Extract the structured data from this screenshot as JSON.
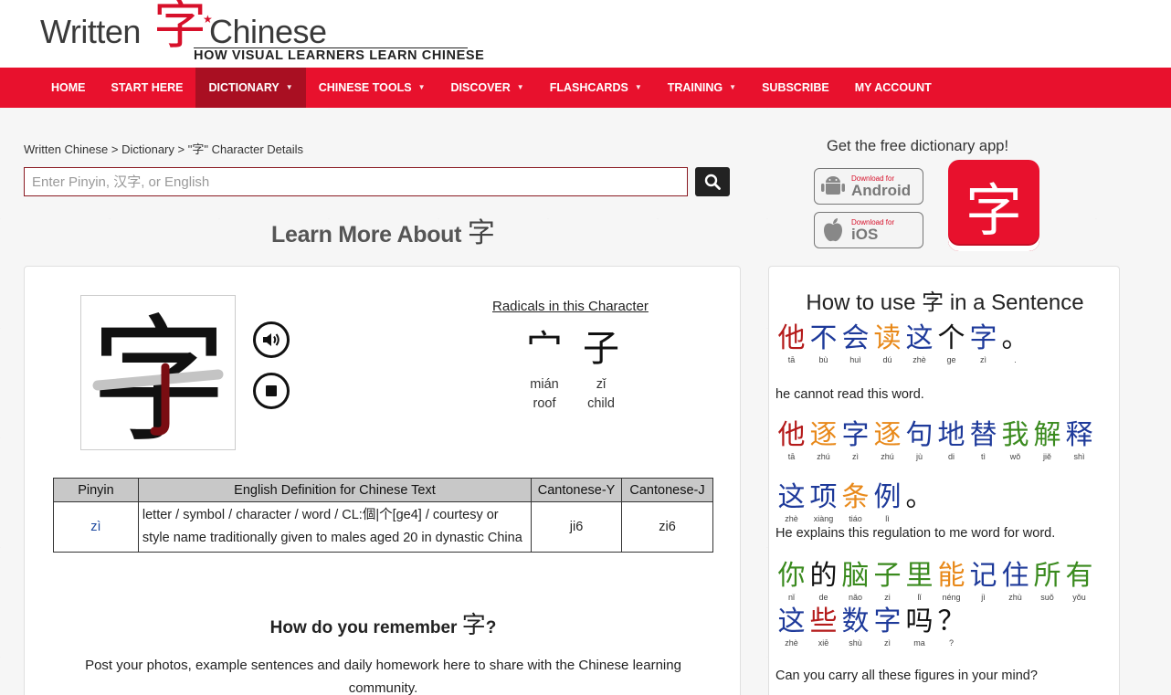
{
  "logo": {
    "word1": "Written",
    "char": "字",
    "word2": "Chinese",
    "tagline": "HOW VISUAL LEARNERS LEARN CHINESE"
  },
  "nav": [
    {
      "label": "HOME",
      "caret": false,
      "active": false
    },
    {
      "label": "START HERE",
      "caret": false,
      "active": false
    },
    {
      "label": "DICTIONARY",
      "caret": true,
      "active": true
    },
    {
      "label": "CHINESE TOOLS",
      "caret": true,
      "active": false
    },
    {
      "label": "DISCOVER",
      "caret": true,
      "active": false
    },
    {
      "label": "FLASHCARDS",
      "caret": true,
      "active": false
    },
    {
      "label": "TRAINING",
      "caret": true,
      "active": false
    },
    {
      "label": "SUBSCRIBE",
      "caret": false,
      "active": false
    },
    {
      "label": "MY ACCOUNT",
      "caret": false,
      "active": false
    }
  ],
  "breadcrumb": {
    "home": "Written Chinese",
    "sep": ">",
    "dictionary": "Dictionary",
    "current": "\"字\" Character Details"
  },
  "search": {
    "placeholder": "Enter Pinyin, 汉字, or English",
    "value": ""
  },
  "learn_more": {
    "text": "Learn More About",
    "char": "字"
  },
  "app": {
    "title": "Get the free dictionary app!",
    "android_small": "Download for",
    "android_big": "Android",
    "ios_small": "Download for",
    "ios_big": "iOS",
    "icon_char": "字"
  },
  "character": {
    "glyph": "字",
    "radicals_title": "Radicals in this Character",
    "radicals": [
      {
        "char": "宀",
        "pinyin": "mián",
        "meaning": "roof"
      },
      {
        "char": "子",
        "pinyin": "zǐ",
        "meaning": "child"
      }
    ]
  },
  "table": {
    "headers": [
      "Pinyin",
      "English Definition for Chinese Text",
      "Cantonese-Y",
      "Cantonese-J"
    ],
    "row": {
      "pinyin": "zì",
      "definition": "letter / symbol / character / word / CL:個|个[ge4] / courtesy or style name traditionally given to males aged 20 in dynastic China",
      "cantonese_y": "ji6",
      "cantonese_j": "zi6"
    }
  },
  "remember": {
    "text": "How do you remember",
    "char": "字",
    "q": "?",
    "post": "Post your photos, example sentences and daily homework here to share with the Chinese learning community."
  },
  "sentences_panel": {
    "title_before": "How to use",
    "char": "字",
    "title_after": "in a Sentence"
  },
  "colors": {
    "brand_red": "#e8112d",
    "nav_active": "#a90f22",
    "tone1": "#b41a1a",
    "tone2": "#e8891a",
    "tone3": "#3a8a1e",
    "tone4": "#1e3a9a",
    "neutral": "#111111"
  },
  "sentences": [
    {
      "chars": [
        {
          "c": "他",
          "p": "tā",
          "t": "tone1"
        },
        {
          "c": "不",
          "p": "bù",
          "t": "tone4"
        },
        {
          "c": "会",
          "p": "huì",
          "t": "tone4"
        },
        {
          "c": "读",
          "p": "dú",
          "t": "tone2"
        },
        {
          "c": "这",
          "p": "zhè",
          "t": "tone4"
        },
        {
          "c": "个",
          "p": "ge",
          "t": "neutral"
        },
        {
          "c": "字",
          "p": "zì",
          "t": "tone4"
        },
        {
          "c": "。",
          "p": ".",
          "t": "neutral"
        }
      ],
      "translation": "he cannot read this word."
    },
    {
      "chars": [
        {
          "c": "他",
          "p": "tā",
          "t": "tone1"
        },
        {
          "c": "逐",
          "p": "zhú",
          "t": "tone2"
        },
        {
          "c": "字",
          "p": "zì",
          "t": "tone4"
        },
        {
          "c": "逐",
          "p": "zhú",
          "t": "tone2"
        },
        {
          "c": "句",
          "p": "jù",
          "t": "tone4"
        },
        {
          "c": "地",
          "p": "di",
          "t": "tone4"
        },
        {
          "c": "替",
          "p": "tì",
          "t": "tone4"
        },
        {
          "c": "我",
          "p": "wǒ",
          "t": "tone3"
        },
        {
          "c": "解",
          "p": "jiě",
          "t": "tone3"
        },
        {
          "c": "释",
          "p": "shì",
          "t": "tone4"
        },
        {
          "c": "这",
          "p": "zhè",
          "t": "tone4"
        },
        {
          "c": "项",
          "p": "xiàng",
          "t": "tone4"
        },
        {
          "c": "条",
          "p": "tiáo",
          "t": "tone2"
        },
        {
          "c": "例",
          "p": "lì",
          "t": "tone4"
        },
        {
          "c": "。",
          "p": "",
          "t": "neutral"
        }
      ],
      "translation": "He explains this regulation to me word for word."
    },
    {
      "chars": [
        {
          "c": "你",
          "p": "nǐ",
          "t": "tone3"
        },
        {
          "c": "的",
          "p": "de",
          "t": "neutral"
        },
        {
          "c": "脑",
          "p": "nǎo",
          "t": "tone3"
        },
        {
          "c": "子",
          "p": "zi",
          "t": "tone3"
        },
        {
          "c": "里",
          "p": "lǐ",
          "t": "tone3"
        },
        {
          "c": "能",
          "p": "néng",
          "t": "tone2"
        },
        {
          "c": "记",
          "p": "jì",
          "t": "tone4"
        },
        {
          "c": "住",
          "p": "zhù",
          "t": "tone4"
        },
        {
          "c": "所",
          "p": "suǒ",
          "t": "tone3"
        },
        {
          "c": "有",
          "p": "yǒu",
          "t": "tone3"
        },
        {
          "c": "这",
          "p": "zhè",
          "t": "tone4"
        },
        {
          "c": "些",
          "p": "xiē",
          "t": "tone1"
        },
        {
          "c": "数",
          "p": "shù",
          "t": "tone4"
        },
        {
          "c": "字",
          "p": "zì",
          "t": "tone4"
        },
        {
          "c": "吗",
          "p": "ma",
          "t": "neutral"
        },
        {
          "c": "？",
          "p": "?",
          "t": "neutral"
        }
      ],
      "translation": "Can you carry all these figures in your mind?"
    }
  ]
}
